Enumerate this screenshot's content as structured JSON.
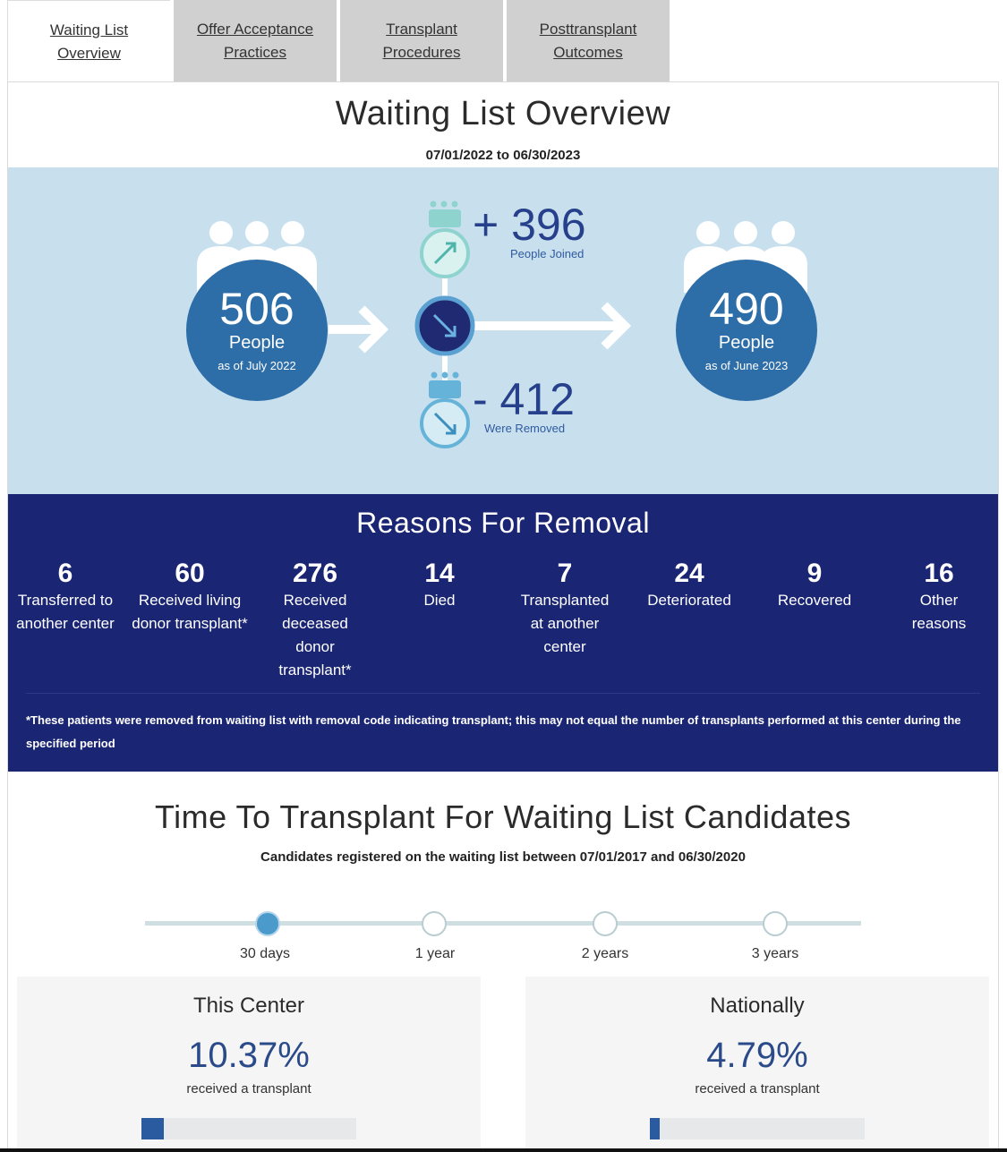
{
  "tabs": [
    {
      "label": "Waiting List Overview",
      "active": true
    },
    {
      "label": "Offer Acceptance Practices",
      "active": false
    },
    {
      "label": "Transplant Procedures",
      "active": false
    },
    {
      "label": "Posttransplant Outcomes",
      "active": false
    }
  ],
  "waiting_list": {
    "title": "Waiting List Overview",
    "dates": "07/01/2022 to 06/30/2023",
    "start": {
      "number": "506",
      "unit": "People",
      "as_of": "as of July 2022"
    },
    "end": {
      "number": "490",
      "unit": "People",
      "as_of": "as of June 2023"
    },
    "joined": {
      "value": "+ 396",
      "label": "People Joined"
    },
    "removed": {
      "value": "- 412",
      "label": "Were Removed"
    }
  },
  "reasons": {
    "title": "Reasons For Removal",
    "items": [
      {
        "count": "6",
        "label": "Transferred to another center"
      },
      {
        "count": "60",
        "label": "Received living donor transplant*"
      },
      {
        "count": "276",
        "label": "Received deceased donor transplant*"
      },
      {
        "count": "14",
        "label": "Died"
      },
      {
        "count": "7",
        "label": "Transplanted at another center"
      },
      {
        "count": "24",
        "label": "Deteriorated"
      },
      {
        "count": "9",
        "label": "Recovered"
      },
      {
        "count": "16",
        "label": "Other reasons"
      }
    ],
    "footnote": "*These patients were removed from waiting list with removal code indicating transplant; this may not equal the number of transplants performed at this center during the specified period"
  },
  "time_to_transplant": {
    "title": "Time To Transplant For Waiting List Candidates",
    "subtitle": "Candidates registered on the waiting list between 07/01/2017 and 06/30/2020",
    "stops": [
      {
        "label": "30 days",
        "active": true
      },
      {
        "label": "1 year",
        "active": false
      },
      {
        "label": "2 years",
        "active": false
      },
      {
        "label": "3 years",
        "active": false
      }
    ],
    "center": {
      "title": "This Center",
      "percent": "10.37%",
      "label": "received a transplant",
      "fraction": 0.1037
    },
    "national": {
      "title": "Nationally",
      "percent": "4.79%",
      "label": "received a transplant",
      "fraction": 0.0479
    }
  },
  "colors": {
    "accent_blue": "#2e6ea8",
    "navy": "#1a2573",
    "light_blue_bg": "#c8e0ee",
    "teal": "#8fd3cf"
  }
}
